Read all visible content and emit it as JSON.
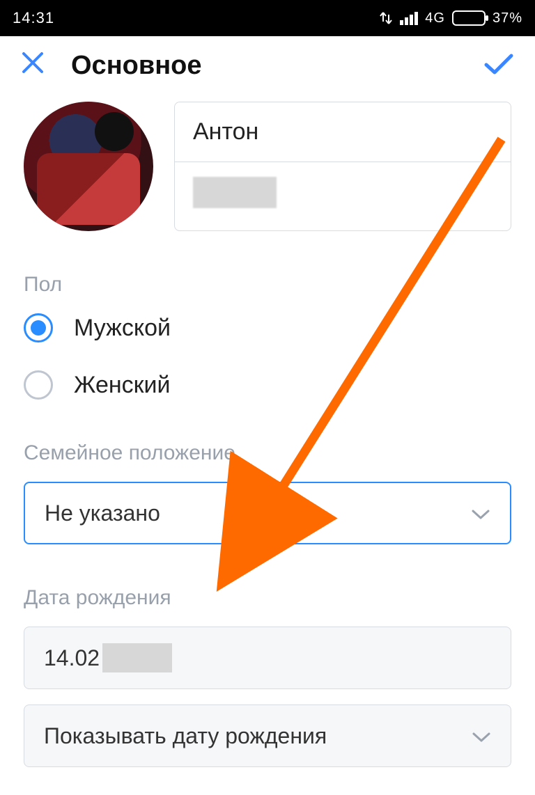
{
  "status": {
    "time": "14:31",
    "network": "4G",
    "battery": "37%"
  },
  "header": {
    "title": "Основное"
  },
  "profile": {
    "first_name": "Антон"
  },
  "gender": {
    "label": "Пол",
    "male": "Мужской",
    "female": "Женский"
  },
  "relationship": {
    "label": "Семейное положение",
    "value": "Не указано"
  },
  "birth": {
    "label": "Дата рождения",
    "value_prefix": "14.02",
    "visibility": "Показывать дату рождения"
  }
}
